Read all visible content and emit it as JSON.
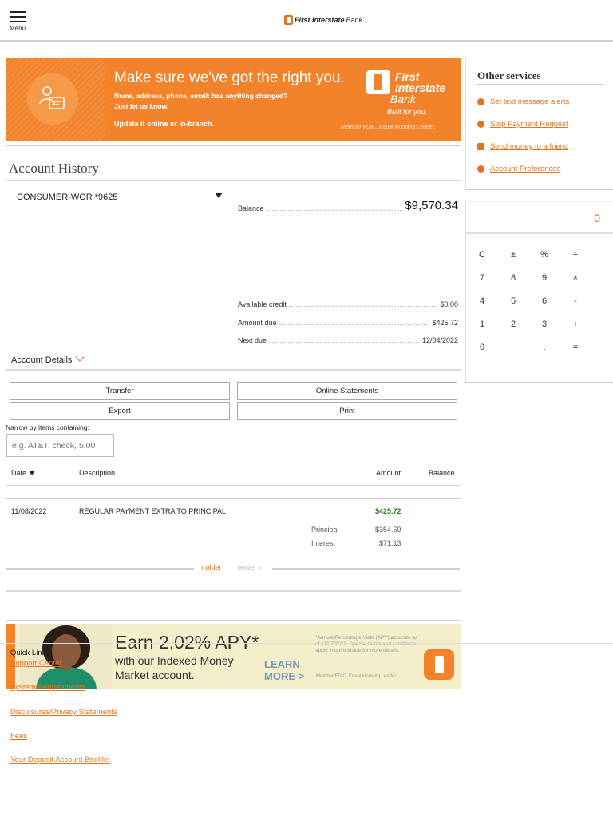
{
  "header": {
    "menu_label": "Menu",
    "logo_text_bold": "First Interstate",
    "logo_text_light": "Bank"
  },
  "promo_banner": {
    "headline": "Make sure we've got the right you.",
    "line1": "Name, address, phone, email: has anything changed?",
    "line2": "Just let us know.",
    "line3": "Update it online or in-branch.",
    "brand_line1": "First",
    "brand_line2": "Interstate",
    "brand_line3": "Bank",
    "tagline": "Built for you.",
    "fdic": "Member FDIC. Equal Housing Lender."
  },
  "account_history": {
    "title": "Account History",
    "account_name": "CONSUMER-WOR  *9625",
    "balance_label": "Balance",
    "balance_value": "$9,570.34",
    "available_credit_label": "Available credit",
    "available_credit_value": "$0.00",
    "amount_due_label": "Amount due",
    "amount_due_value": "$425.72",
    "next_due_label": "Next due",
    "next_due_value": "12/04/2022",
    "account_details_label": "Account Details",
    "buttons": {
      "transfer": "Transfer",
      "online_statements": "Online Statements",
      "export": "Export",
      "print": "Print"
    },
    "filter_label": "Narrow by items containing:",
    "filter_placeholder": "e.g. AT&T, check, 5.00",
    "columns": {
      "date": "Date",
      "description": "Description",
      "amount": "Amount",
      "balance": "Balance"
    },
    "transactions": [
      {
        "date": "11/08/2022",
        "description": "REGULAR PAYMENT EXTRA TO PRINCIPAL",
        "amount": "$425.72",
        "balance": "",
        "principal_label": "Principal",
        "principal_value": "$354.59",
        "interest_label": "Interest",
        "interest_value": "$71.13"
      }
    ],
    "pager": {
      "older": "older",
      "newer": "newer"
    }
  },
  "apy_banner": {
    "headline": "Earn 2.02% APY*",
    "line1": "with our Indexed Money",
    "line2": "Market account.",
    "cta_line1": "LEARN",
    "cta_line2": "MORE >",
    "fine_print": "*Annual Percentage Yield (APY) accurate as of 11/07/2022. Special terms and conditions apply. Inquire inside for more details.",
    "fdic": "Member FDIC. Equal Housing Lender."
  },
  "other_services": {
    "title": "Other services",
    "items": [
      {
        "label": "Set text message alerts",
        "icon": "chat-bubble-icon"
      },
      {
        "label": "Stop Payment Request",
        "icon": "stop-icon"
      },
      {
        "label": "Send money to a friend",
        "icon": "send-money-icon"
      },
      {
        "label": "Account Preferences",
        "icon": "gear-icon"
      }
    ]
  },
  "calculator": {
    "display": "0",
    "keys": [
      "C",
      "±",
      "%",
      "÷",
      "7",
      "8",
      "9",
      "×",
      "4",
      "5",
      "6",
      "-",
      "1",
      "2",
      "3",
      "+",
      "0",
      ".",
      "="
    ]
  },
  "footer": {
    "quick_links_title": "Quick Links",
    "links": [
      "Support Center",
      "System Requirements",
      "Disclosures/Privacy Statements",
      "Fees",
      "Your Deposit Account Booklet"
    ]
  },
  "colors": {
    "accent": "#e8711f",
    "banner_orange": "#f2832b",
    "amount_green": "#2e7d1e"
  }
}
